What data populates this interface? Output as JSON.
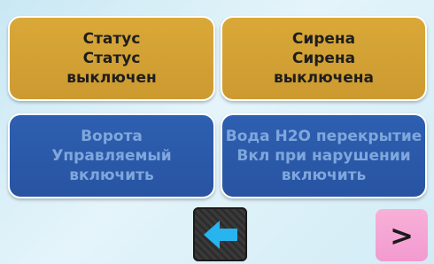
{
  "tiles": [
    {
      "line1": "Статус",
      "line2": "Статус",
      "line3": "выключен"
    },
    {
      "line1": "Сирена",
      "line2": "Сирена",
      "line3": "выключена"
    },
    {
      "line1": "Ворота",
      "line2": "Управляемый",
      "line3": "включить"
    },
    {
      "line1": "Вода H2O перекрытие",
      "line2": "Вкл при нарушении",
      "line3": "включить"
    }
  ],
  "nav": {
    "back_icon": "arrow-left-icon",
    "next_label": ">"
  },
  "colors": {
    "gold_tile": "#d0a035",
    "blue_tile": "#2c58a8",
    "blue_text": "#7fa7dc",
    "next_button": "#f4a2d4",
    "arrow": "#27b4ef"
  }
}
